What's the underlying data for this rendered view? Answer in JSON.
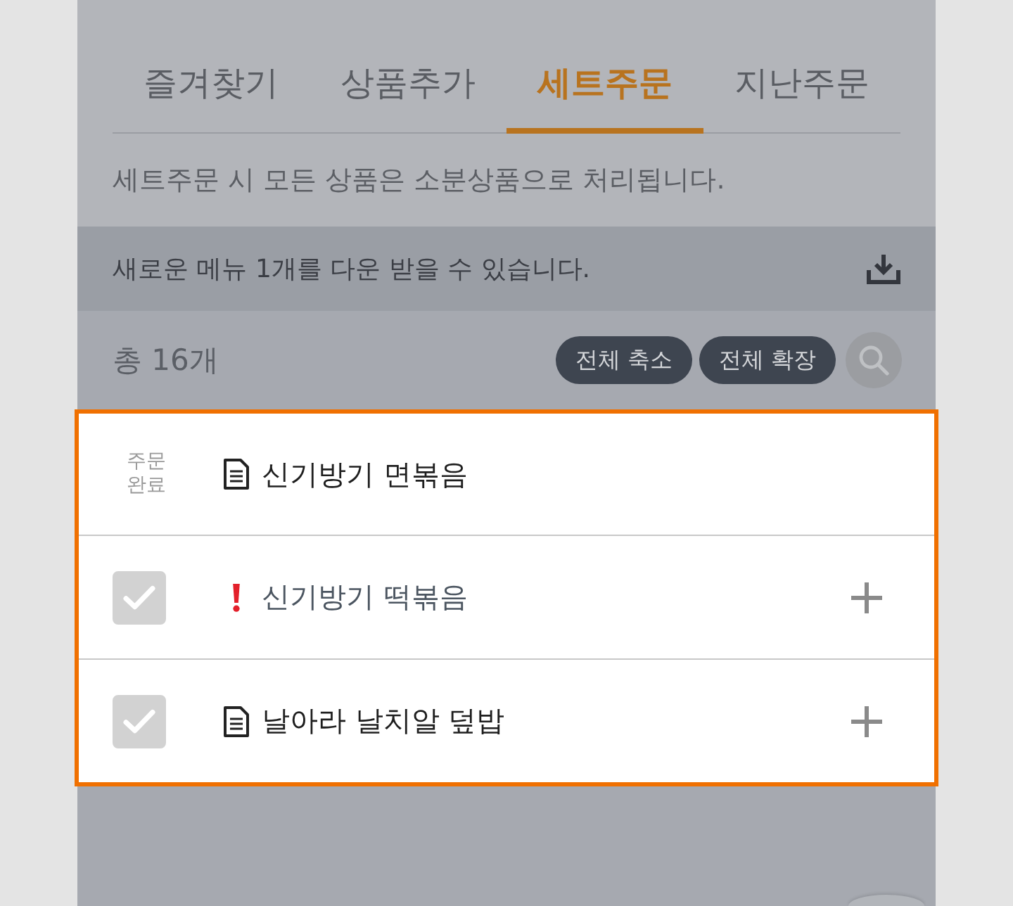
{
  "tabs": [
    {
      "label": "즐겨찾기",
      "selected": false
    },
    {
      "label": "상품추가",
      "selected": false
    },
    {
      "label": "세트주문",
      "selected": true
    },
    {
      "label": "지난주문",
      "selected": false
    }
  ],
  "notice": "세트주문 시 모든 상품은 소분상품으로 처리됩니다.",
  "download_bar": {
    "message": "새로운 메뉴 1개를 다운 받을 수 있습니다."
  },
  "summary": {
    "count": "총 16개",
    "buttons": [
      "전체 축소",
      "전체 확장"
    ]
  },
  "list": {
    "highlighted": true,
    "items": [
      {
        "kind": "ordered",
        "status": "주문 완료",
        "warning": false,
        "name": "신기방기 면볶음"
      },
      {
        "kind": "selectable",
        "checked": true,
        "warning": true,
        "name": "신기방기 떡볶음"
      },
      {
        "kind": "selectable",
        "checked": true,
        "warning": false,
        "name": "날아라 날치알 덮밥"
      }
    ]
  }
}
